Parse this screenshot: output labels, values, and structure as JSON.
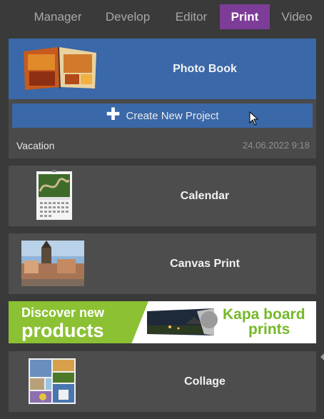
{
  "tabs": [
    {
      "label": "Manager",
      "active": false
    },
    {
      "label": "Develop",
      "active": false
    },
    {
      "label": "Editor",
      "active": false
    },
    {
      "label": "Print",
      "active": true
    },
    {
      "label": "Video",
      "active": false
    }
  ],
  "products": {
    "photo_book": {
      "label": "Photo Book",
      "create_label": "Create New Project",
      "project": {
        "name": "Vacation",
        "date": "24.06.2022 9:18"
      }
    },
    "calendar": {
      "label": "Calendar"
    },
    "canvas_print": {
      "label": "Canvas Print"
    },
    "collage": {
      "label": "Collage"
    }
  },
  "banner": {
    "line1": "Discover new",
    "line2": "products",
    "right_line1": "Kapa board",
    "right_line2": "prints"
  },
  "colors": {
    "accent": "#7d3c98",
    "selected": "#3a68a8",
    "banner_green": "#8bc133"
  },
  "icons": {
    "create": "plus-icon",
    "pointer": "mouse-cursor-icon"
  }
}
